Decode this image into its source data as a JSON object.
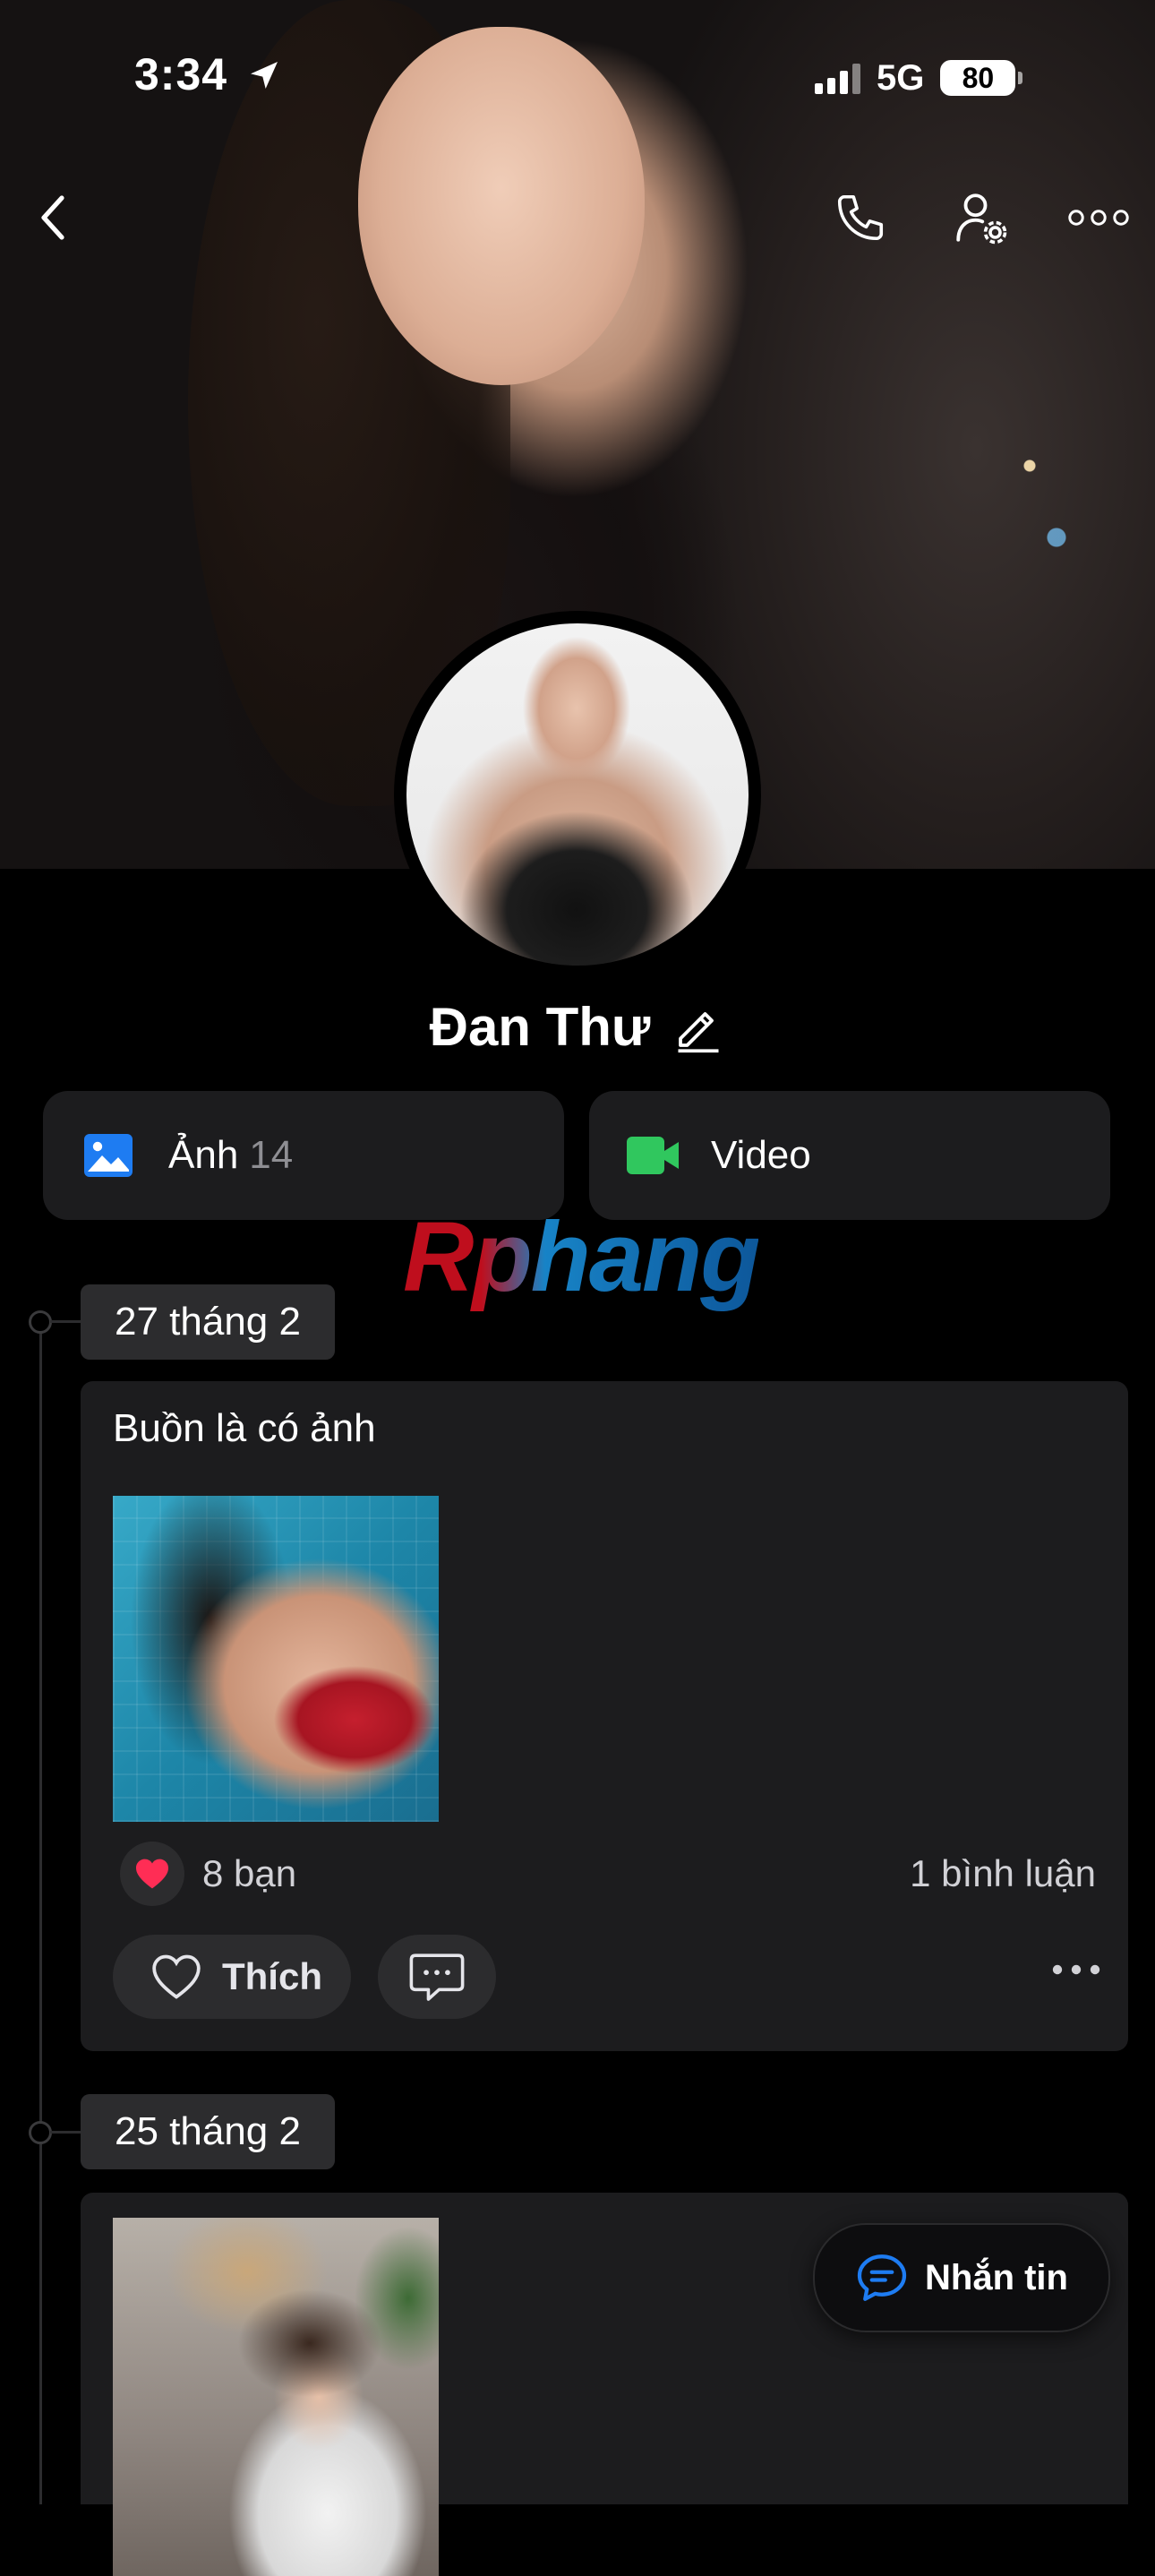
{
  "status_bar": {
    "time": "3:34",
    "network": "5G",
    "battery": "80"
  },
  "profile": {
    "name": "Đan Thư"
  },
  "media_buttons": [
    {
      "label": "Ảnh",
      "count": "14",
      "icon": "photo-icon",
      "color": "#1e7cf2"
    },
    {
      "label": "Video",
      "icon": "video-icon",
      "color": "#30c75e"
    }
  ],
  "watermark": "Rphang",
  "posts": [
    {
      "date": "27 tháng 2",
      "caption": "Buồn là có ảnh",
      "reactions": "8 bạn",
      "comments": "1 bình luận",
      "like_label": "Thích"
    },
    {
      "date": "25 tháng 2"
    }
  ],
  "floating": {
    "message_label": "Nhắn tin"
  },
  "colors": {
    "accent": "#1e7cf2",
    "heart": "#ff2d55",
    "card": "#1c1c1e"
  }
}
